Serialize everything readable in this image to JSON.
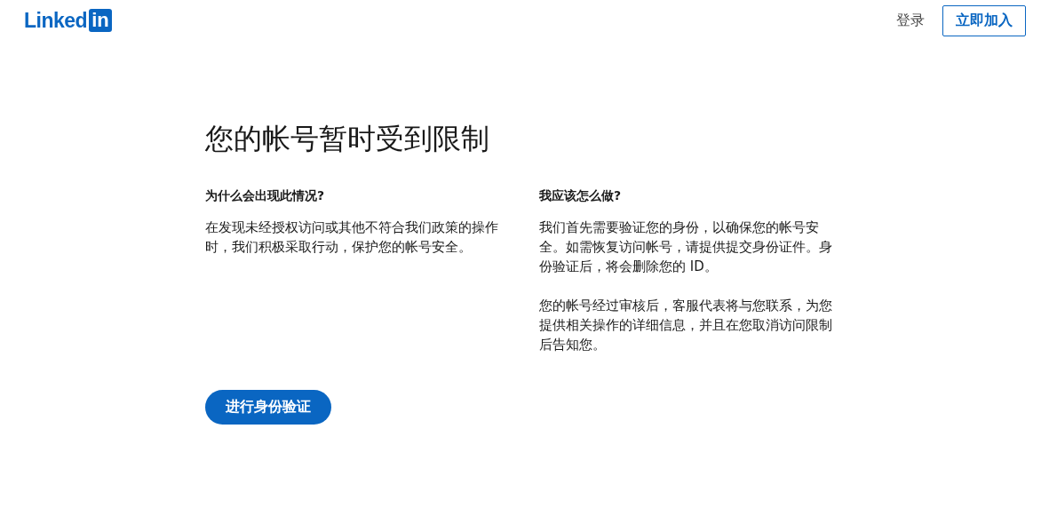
{
  "header": {
    "logo": {
      "text": "Linked",
      "badge": "in"
    },
    "sign_in": "登录",
    "join": "立即加入"
  },
  "title": "您的帐号暂时受到限制",
  "sections": [
    {
      "heading": "为什么会出现此情况?",
      "paragraphs": [
        "在发现未经授权访问或其他不符合我们政策的操作时，我们积极采取行动，保护您的帐号安全。"
      ]
    },
    {
      "heading": "我应该怎么做?",
      "paragraphs": [
        "我们首先需要验证您的身份，以确保您的帐号安全。如需恢复访问帐号，请提供提交身份证件。身份验证后，将会删除您的 ID。",
        "您的帐号经过审核后，客服代表将与您联系，为您提供相关操作的详细信息，并且在您取消访问限制后告知您。"
      ]
    }
  ],
  "action": "进行身份验证"
}
